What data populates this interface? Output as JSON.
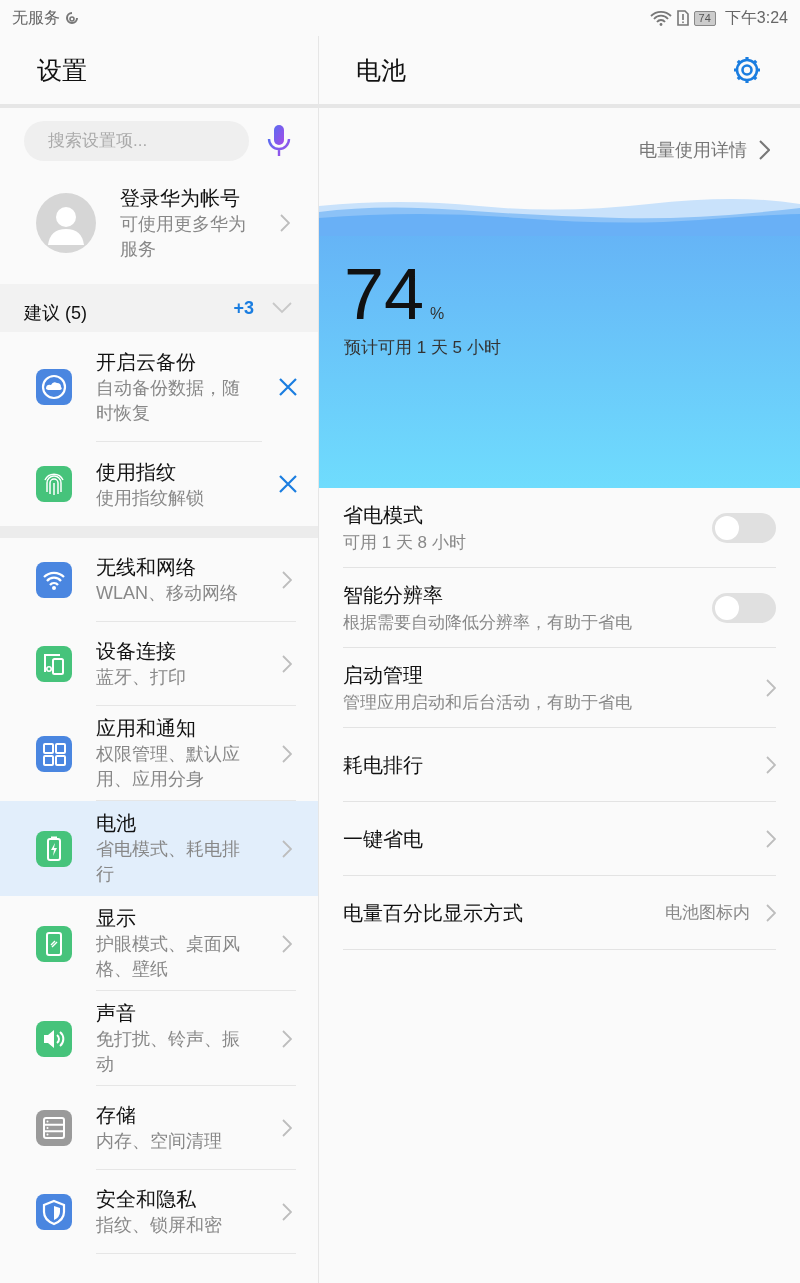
{
  "status_bar": {
    "carrier": "无服务",
    "battery": "74",
    "time": "下午3:24"
  },
  "sidebar": {
    "title": "设置",
    "search": {
      "placeholder": "搜索设置项..."
    },
    "account": {
      "title": "登录华为帐号",
      "subtitle": "可使用更多华为服务"
    },
    "suggestions": {
      "title": "建议 (5)",
      "more": "+3",
      "items": [
        {
          "title": "开启云备份",
          "subtitle": "自动备份数据，随时恢复",
          "color": "#4a86e0"
        },
        {
          "title": "使用指纹",
          "subtitle": "使用指纹解锁",
          "color": "#46c37b"
        }
      ]
    },
    "items": [
      {
        "title": "无线和网络",
        "subtitle": "WLAN、移动网络",
        "color": "#4a86e0",
        "selected": false
      },
      {
        "title": "设备连接",
        "subtitle": "蓝牙、打印",
        "color": "#46c37b",
        "selected": false
      },
      {
        "title": "应用和通知",
        "subtitle": "权限管理、默认应用、应用分身",
        "color": "#4a86e0",
        "selected": false
      },
      {
        "title": "电池",
        "subtitle": "省电模式、耗电排行",
        "color": "#46c37b",
        "selected": true
      },
      {
        "title": "显示",
        "subtitle": "护眼模式、桌面风格、壁纸",
        "color": "#46c37b",
        "selected": false
      },
      {
        "title": "声音",
        "subtitle": "免打扰、铃声、振动",
        "color": "#46c37b",
        "selected": false
      },
      {
        "title": "存储",
        "subtitle": "内存、空间清理",
        "color": "#9a9a9a",
        "selected": false
      },
      {
        "title": "安全和隐私",
        "subtitle": "指纹、锁屏和密",
        "color": "#4a86e0",
        "selected": false
      }
    ]
  },
  "detail": {
    "title": "电池",
    "usage_link": "电量使用详情",
    "battery": {
      "percent": "74",
      "unit": "%",
      "estimate": "预计可用 1 天 5 小时"
    },
    "rows": [
      {
        "kind": "toggle",
        "title": "省电模式",
        "subtitle": "可用 1 天 8 小时",
        "on": false
      },
      {
        "kind": "toggle",
        "title": "智能分辨率",
        "subtitle": "根据需要自动降低分辨率，有助于省电",
        "on": false
      },
      {
        "kind": "link",
        "title": "启动管理",
        "subtitle": "管理应用启动和后台活动，有助于省电"
      },
      {
        "kind": "link",
        "title": "耗电排行"
      },
      {
        "kind": "link",
        "title": "一键省电"
      },
      {
        "kind": "link",
        "title": "电量百分比显示方式",
        "value": "电池图标内"
      }
    ]
  }
}
